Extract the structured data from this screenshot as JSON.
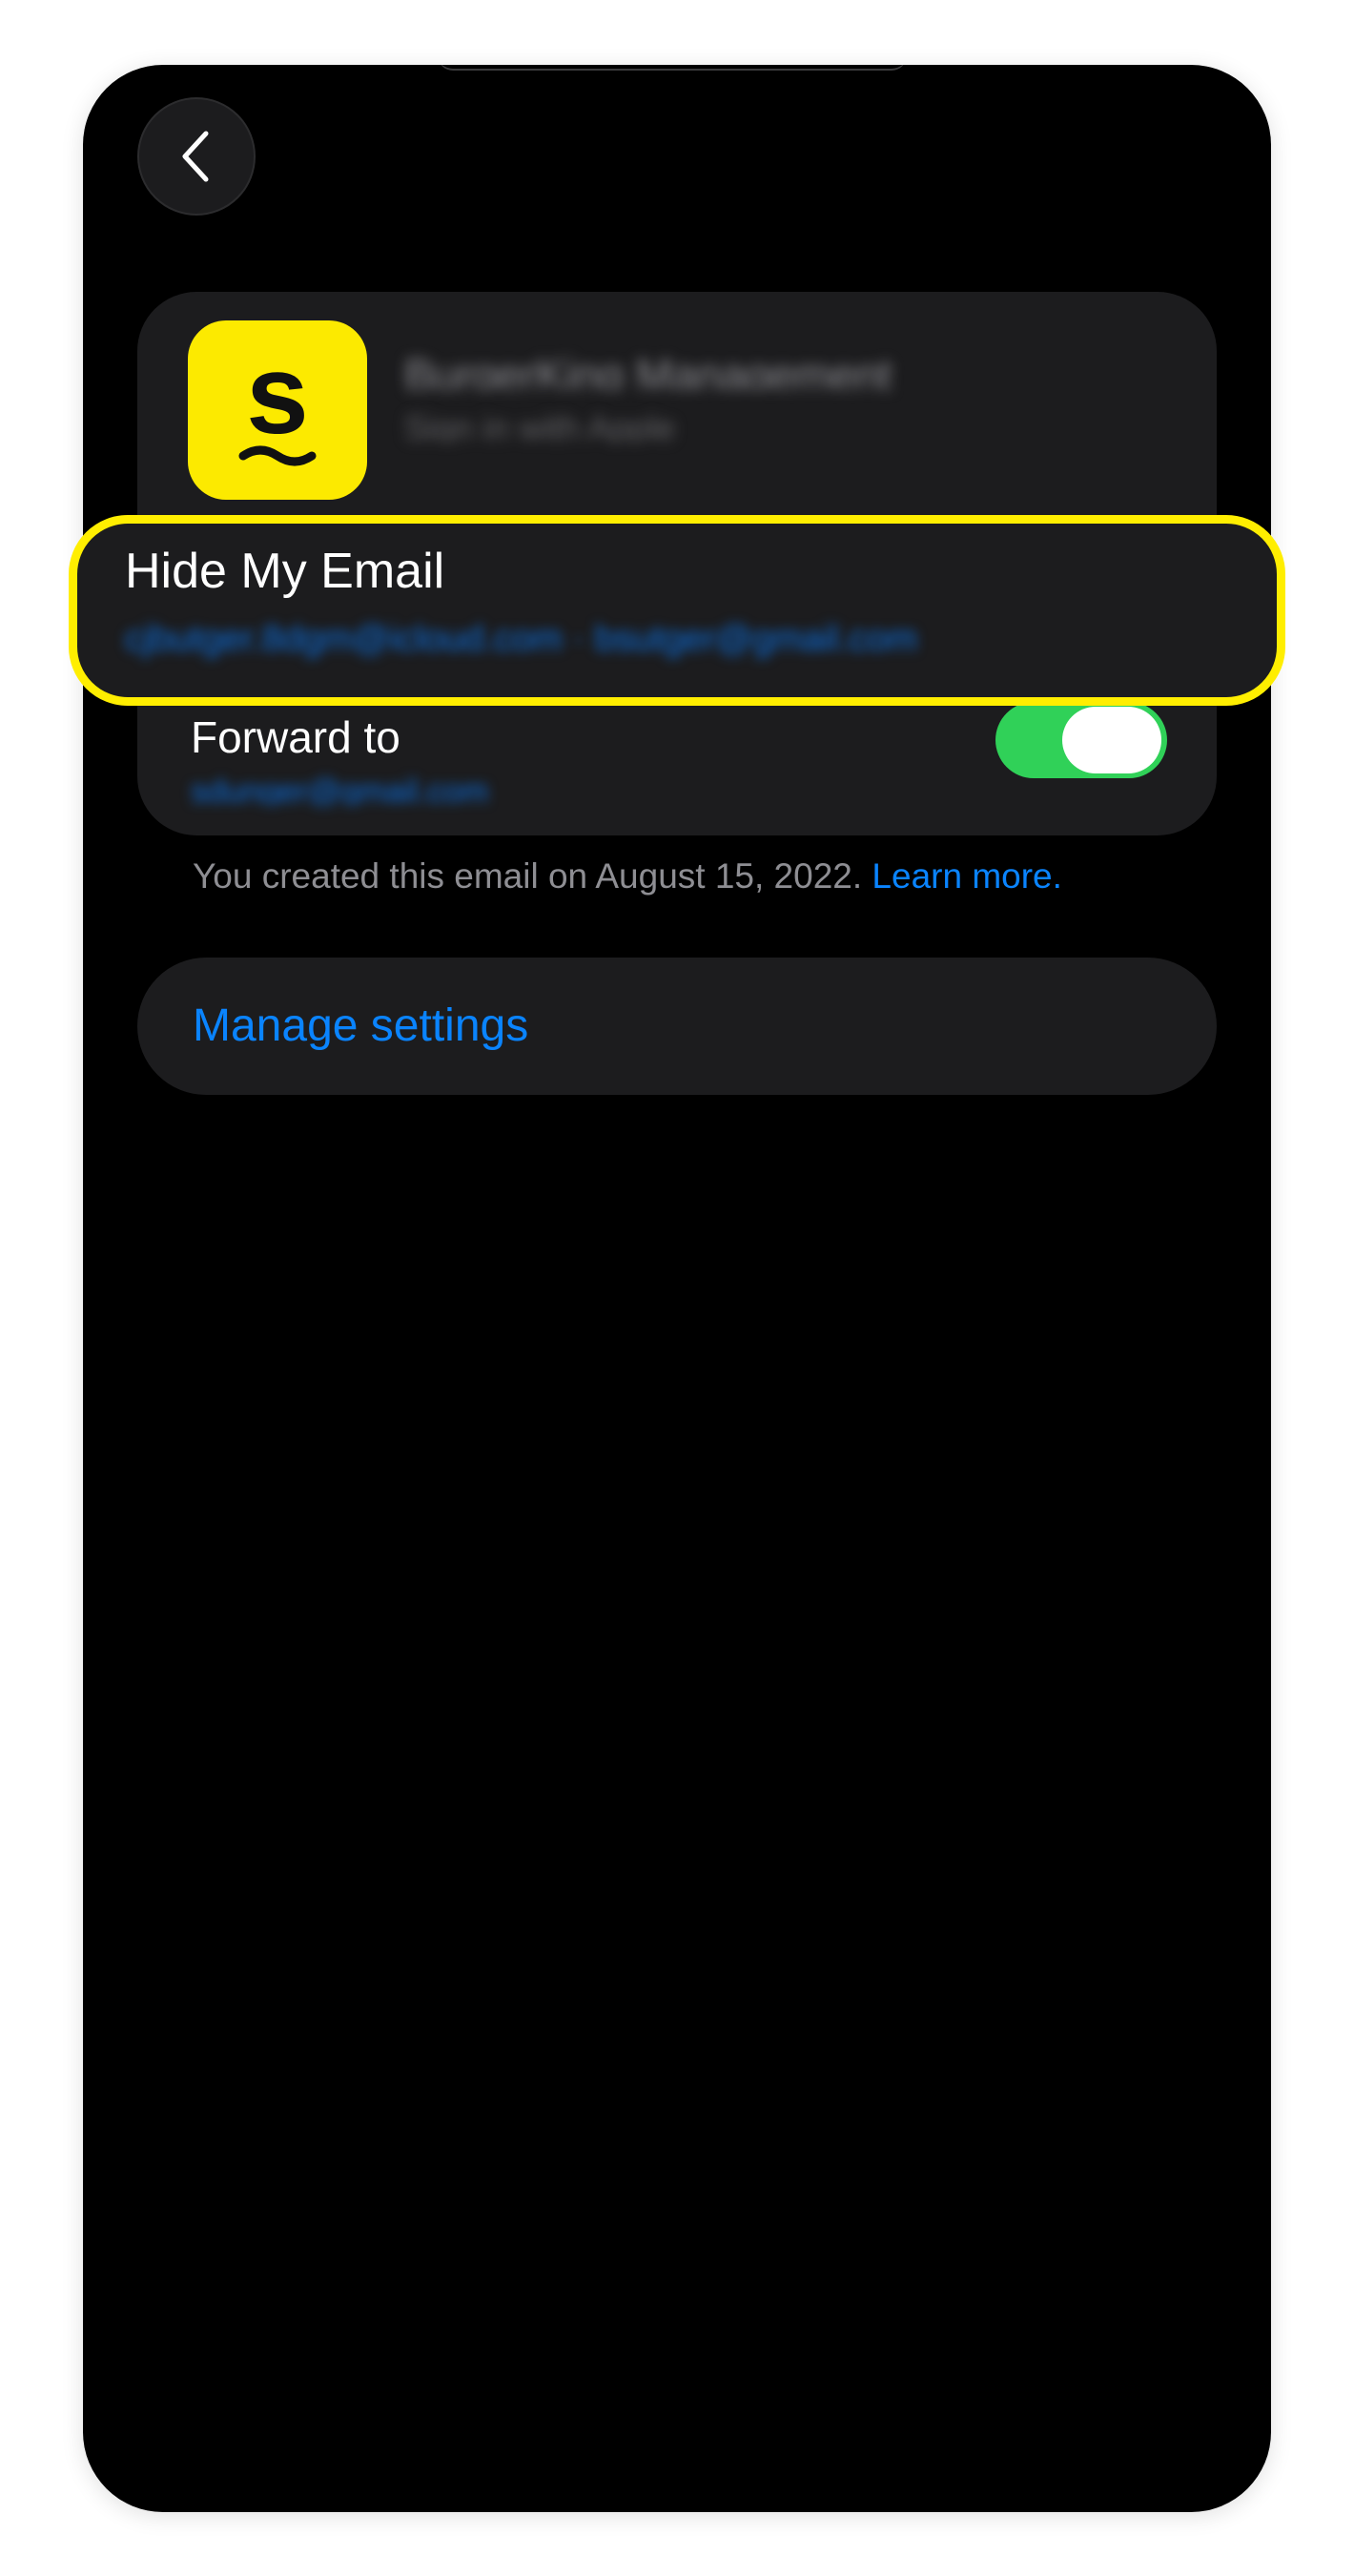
{
  "app": {
    "name": "BurgerKing Management",
    "subtitle": "Sign in with Apple"
  },
  "hide_my_email": {
    "title": "Hide My Email",
    "email": "cjbutger.8dgm@icloud.com · bsutger@gmail.com"
  },
  "forward": {
    "label": "Forward to",
    "email": "sdunger@gmail.com",
    "enabled": true
  },
  "footer": {
    "note": "You created this email on August 15, 2022.",
    "link": "Learn more."
  },
  "manage": {
    "label": "Manage settings"
  },
  "colors": {
    "accent": "#0a84ff",
    "toggle_on": "#30d158",
    "highlight": "#ffee00",
    "app_icon": "#fcea00"
  }
}
